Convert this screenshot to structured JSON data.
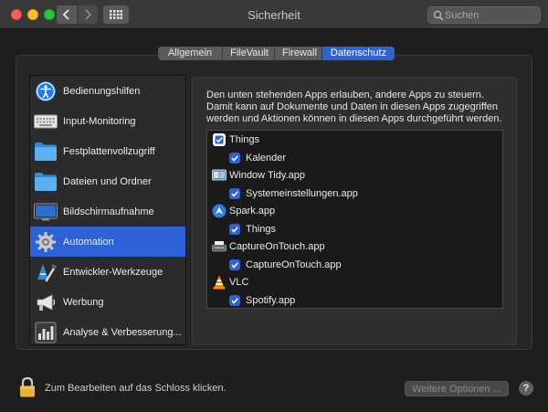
{
  "window": {
    "title": "Sicherheit"
  },
  "search": {
    "placeholder": "Suchen"
  },
  "tabs": [
    {
      "label": "Allgemein",
      "active": false
    },
    {
      "label": "FileVault",
      "active": false
    },
    {
      "label": "Firewall",
      "active": false
    },
    {
      "label": "Datenschutz",
      "active": true
    }
  ],
  "sidebar": {
    "items": [
      {
        "label": "Bedienungshilfen",
        "icon": "accessibility-icon"
      },
      {
        "label": "Input-Monitoring",
        "icon": "keyboard-icon"
      },
      {
        "label": "Festplattenvollzugriff",
        "icon": "folder-icon"
      },
      {
        "label": "Dateien und Ordner",
        "icon": "folder-icon"
      },
      {
        "label": "Bildschirmaufnahme",
        "icon": "display-icon"
      },
      {
        "label": "Automation",
        "icon": "gear-icon",
        "selected": true
      },
      {
        "label": "Entwickler-Werkzeuge",
        "icon": "developer-tools-icon"
      },
      {
        "label": "Werbung",
        "icon": "megaphone-icon"
      },
      {
        "label": "Analyse & Verbesserung...",
        "icon": "analytics-icon"
      }
    ]
  },
  "main": {
    "description": "Den unten stehenden Apps erlauben, andere Apps zu steuern. Damit kann auf Dokumente und Daten in diesen Apps zugegriffen werden und Aktionen können in diesen Apps durchgeführt werden.",
    "apps": [
      {
        "name": "Things",
        "icon": "things-icon",
        "permissions": [
          {
            "label": "Kalender",
            "checked": true
          }
        ]
      },
      {
        "name": "Window Tidy.app",
        "icon": "window-tidy-icon",
        "permissions": [
          {
            "label": "Systemeinstellungen.app",
            "checked": true
          }
        ]
      },
      {
        "name": "Spark.app",
        "icon": "spark-icon",
        "permissions": [
          {
            "label": "Things",
            "checked": true
          }
        ]
      },
      {
        "name": "CaptureOnTouch.app",
        "icon": "scanner-icon",
        "permissions": [
          {
            "label": "CaptureOnTouch.app",
            "checked": true
          }
        ]
      },
      {
        "name": "VLC",
        "icon": "vlc-cone-icon",
        "permissions": [
          {
            "label": "Spotify.app",
            "checked": true
          }
        ]
      }
    ]
  },
  "footer": {
    "lock_text": "Zum Bearbeiten auf das Schloss klicken.",
    "more_options_label": "Weitere Optionen ...",
    "help_label": "?"
  },
  "colors": {
    "accent": "#2e62d7",
    "background": "#1e1e1e"
  }
}
